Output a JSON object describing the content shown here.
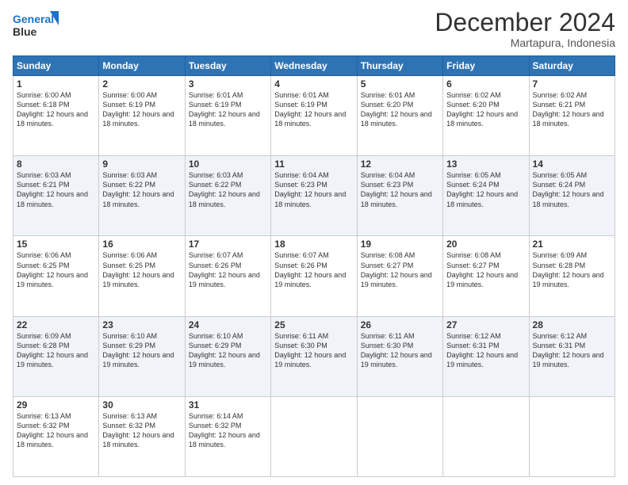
{
  "header": {
    "logo_line1": "General",
    "logo_line2": "Blue",
    "month_title": "December 2024",
    "location": "Martapura, Indonesia"
  },
  "days_of_week": [
    "Sunday",
    "Monday",
    "Tuesday",
    "Wednesday",
    "Thursday",
    "Friday",
    "Saturday"
  ],
  "weeks": [
    [
      {
        "day": "1",
        "sunrise": "6:00 AM",
        "sunset": "6:18 PM",
        "daylight": "12 hours and 18 minutes."
      },
      {
        "day": "2",
        "sunrise": "6:00 AM",
        "sunset": "6:19 PM",
        "daylight": "12 hours and 18 minutes."
      },
      {
        "day": "3",
        "sunrise": "6:01 AM",
        "sunset": "6:19 PM",
        "daylight": "12 hours and 18 minutes."
      },
      {
        "day": "4",
        "sunrise": "6:01 AM",
        "sunset": "6:19 PM",
        "daylight": "12 hours and 18 minutes."
      },
      {
        "day": "5",
        "sunrise": "6:01 AM",
        "sunset": "6:20 PM",
        "daylight": "12 hours and 18 minutes."
      },
      {
        "day": "6",
        "sunrise": "6:02 AM",
        "sunset": "6:20 PM",
        "daylight": "12 hours and 18 minutes."
      },
      {
        "day": "7",
        "sunrise": "6:02 AM",
        "sunset": "6:21 PM",
        "daylight": "12 hours and 18 minutes."
      }
    ],
    [
      {
        "day": "8",
        "sunrise": "6:03 AM",
        "sunset": "6:21 PM",
        "daylight": "12 hours and 18 minutes."
      },
      {
        "day": "9",
        "sunrise": "6:03 AM",
        "sunset": "6:22 PM",
        "daylight": "12 hours and 18 minutes."
      },
      {
        "day": "10",
        "sunrise": "6:03 AM",
        "sunset": "6:22 PM",
        "daylight": "12 hours and 18 minutes."
      },
      {
        "day": "11",
        "sunrise": "6:04 AM",
        "sunset": "6:23 PM",
        "daylight": "12 hours and 18 minutes."
      },
      {
        "day": "12",
        "sunrise": "6:04 AM",
        "sunset": "6:23 PM",
        "daylight": "12 hours and 18 minutes."
      },
      {
        "day": "13",
        "sunrise": "6:05 AM",
        "sunset": "6:24 PM",
        "daylight": "12 hours and 18 minutes."
      },
      {
        "day": "14",
        "sunrise": "6:05 AM",
        "sunset": "6:24 PM",
        "daylight": "12 hours and 18 minutes."
      }
    ],
    [
      {
        "day": "15",
        "sunrise": "6:06 AM",
        "sunset": "6:25 PM",
        "daylight": "12 hours and 19 minutes."
      },
      {
        "day": "16",
        "sunrise": "6:06 AM",
        "sunset": "6:25 PM",
        "daylight": "12 hours and 19 minutes."
      },
      {
        "day": "17",
        "sunrise": "6:07 AM",
        "sunset": "6:26 PM",
        "daylight": "12 hours and 19 minutes."
      },
      {
        "day": "18",
        "sunrise": "6:07 AM",
        "sunset": "6:26 PM",
        "daylight": "12 hours and 19 minutes."
      },
      {
        "day": "19",
        "sunrise": "6:08 AM",
        "sunset": "6:27 PM",
        "daylight": "12 hours and 19 minutes."
      },
      {
        "day": "20",
        "sunrise": "6:08 AM",
        "sunset": "6:27 PM",
        "daylight": "12 hours and 19 minutes."
      },
      {
        "day": "21",
        "sunrise": "6:09 AM",
        "sunset": "6:28 PM",
        "daylight": "12 hours and 19 minutes."
      }
    ],
    [
      {
        "day": "22",
        "sunrise": "6:09 AM",
        "sunset": "6:28 PM",
        "daylight": "12 hours and 19 minutes."
      },
      {
        "day": "23",
        "sunrise": "6:10 AM",
        "sunset": "6:29 PM",
        "daylight": "12 hours and 19 minutes."
      },
      {
        "day": "24",
        "sunrise": "6:10 AM",
        "sunset": "6:29 PM",
        "daylight": "12 hours and 19 minutes."
      },
      {
        "day": "25",
        "sunrise": "6:11 AM",
        "sunset": "6:30 PM",
        "daylight": "12 hours and 19 minutes."
      },
      {
        "day": "26",
        "sunrise": "6:11 AM",
        "sunset": "6:30 PM",
        "daylight": "12 hours and 19 minutes."
      },
      {
        "day": "27",
        "sunrise": "6:12 AM",
        "sunset": "6:31 PM",
        "daylight": "12 hours and 19 minutes."
      },
      {
        "day": "28",
        "sunrise": "6:12 AM",
        "sunset": "6:31 PM",
        "daylight": "12 hours and 19 minutes."
      }
    ],
    [
      {
        "day": "29",
        "sunrise": "6:13 AM",
        "sunset": "6:32 PM",
        "daylight": "12 hours and 18 minutes."
      },
      {
        "day": "30",
        "sunrise": "6:13 AM",
        "sunset": "6:32 PM",
        "daylight": "12 hours and 18 minutes."
      },
      {
        "day": "31",
        "sunrise": "6:14 AM",
        "sunset": "6:32 PM",
        "daylight": "12 hours and 18 minutes."
      },
      null,
      null,
      null,
      null
    ]
  ]
}
